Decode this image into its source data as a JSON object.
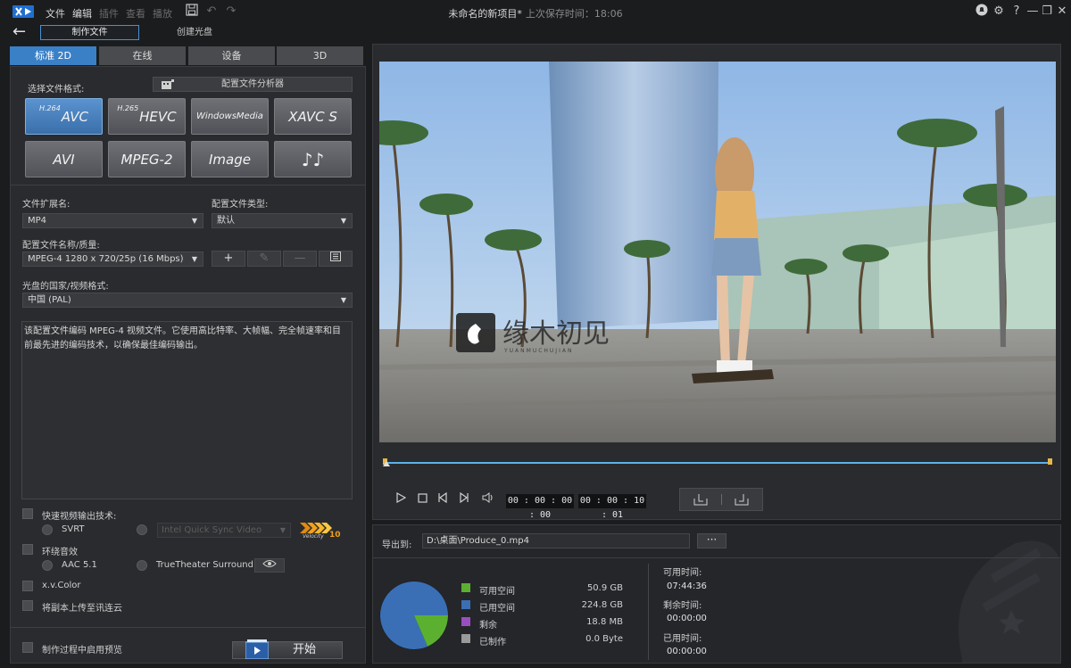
{
  "titlebar": {
    "menu": [
      "文件",
      "编辑",
      "插件",
      "查看",
      "播放"
    ],
    "title": "未命名的新项目*",
    "saved_label": "上次保存时间：18:06"
  },
  "modebar": {
    "produce": "制作文件",
    "disc": "创建光盘"
  },
  "tabs": [
    "标准 2D",
    "在线",
    "设备",
    "3D"
  ],
  "left": {
    "format_label": "选择文件格式:",
    "profile_analyzer": "配置文件分析器",
    "formats": [
      {
        "sup": "H.264",
        "label": "AVC"
      },
      {
        "sup": "H.265",
        "label": "HEVC"
      },
      {
        "sup": "",
        "label": "WindowsMedia"
      },
      {
        "sup": "",
        "label": "XAVC S"
      },
      {
        "sup": "",
        "label": "AVI"
      },
      {
        "sup": "",
        "label": "MPEG-2"
      },
      {
        "sup": "",
        "label": "Image"
      },
      {
        "sup": "",
        "label": "♪♪"
      }
    ],
    "ext_label": "文件扩展名:",
    "ext_value": "MP4",
    "profile_type_label": "配置文件类型:",
    "profile_type_value": "默认",
    "profile_name_label": "配置文件名称/质量:",
    "profile_name_value": "MPEG-4 1280 x 720/25p (16 Mbps)",
    "region_label": "光盘的国家/视频格式:",
    "region_value": "中国 (PAL)",
    "description": "该配置文件编码 MPEG-4 视频文件。它使用高比特率、大帧幅、完全帧速率和目前最先进的编码技术，以确保最佳编码输出。",
    "fast_render_label": "快速视频输出技术:",
    "svrt_label": "SVRT",
    "qsv_value": "Intel Quick Sync Video",
    "truevelocity_label": "Velocity",
    "truevelocity_num": "10",
    "surround_label": "环绕音效",
    "aac_label": "AAC 5.1",
    "truetheater_label": "TrueTheater Surround",
    "xvcolor_label": "x.v.Color",
    "upload_label": "将副本上传至讯连云",
    "preview_label": "制作过程中启用预览",
    "start_label": "开始"
  },
  "player": {
    "watermark_text": "缘木初见",
    "watermark_sub": "YUANMUCHUJIAN",
    "timecode_current": "00 : 00 : 00 : 00",
    "timecode_total": "00 : 00 : 10 : 01"
  },
  "export": {
    "export_label": "导出到:",
    "path": "D:\\桌面\\Produce_0.mp4",
    "browse": "···",
    "legend": [
      {
        "label": "可用空间",
        "value": "50.9  GB",
        "color": "#5cb030"
      },
      {
        "label": "已用空间",
        "value": "224.8  GB",
        "color": "#3a6fb5"
      },
      {
        "label": "剩余",
        "value": "18.8  MB",
        "color": "#9a4fc0"
      },
      {
        "label": "已制作",
        "value": "0.0  Byte",
        "color": "#9a9a9a"
      }
    ],
    "pie": {
      "free_gb": 50.9,
      "used_gb": 224.8
    },
    "available_time_label": "可用时间:",
    "available_time": "07:44:36",
    "remaining_time_label": "剩余时间:",
    "remaining_time": "00:00:00",
    "elapsed_time_label": "已用时间:",
    "elapsed_time": "00:00:00"
  },
  "colors": {
    "accent": "#3a80c6",
    "free": "#5cb030",
    "used": "#3a6fb5"
  }
}
